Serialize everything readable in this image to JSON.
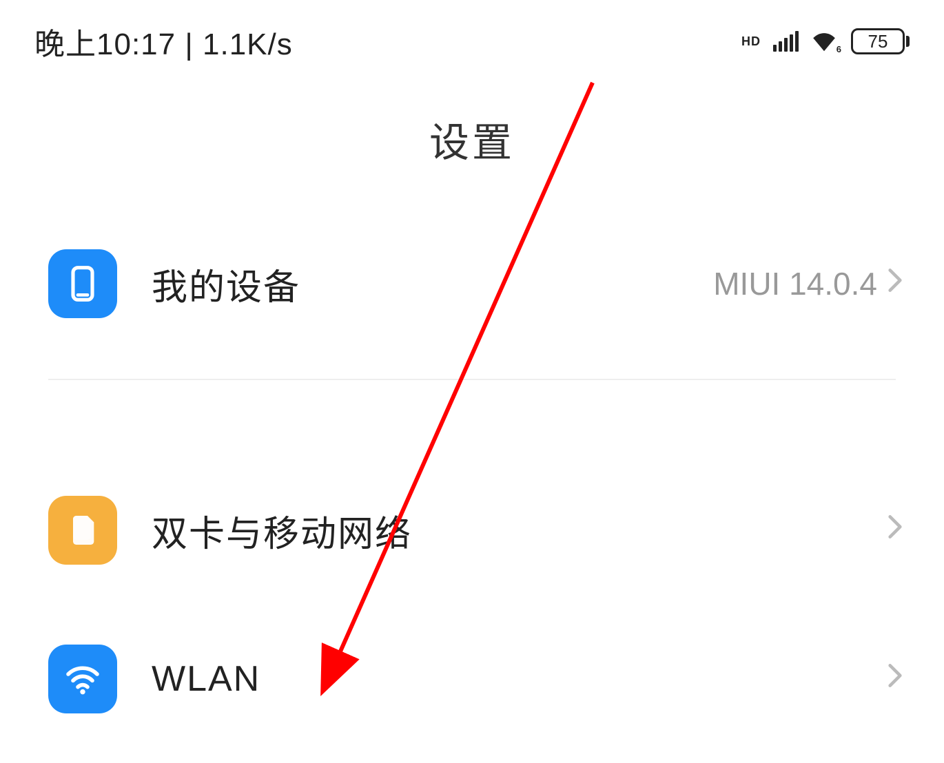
{
  "status_bar": {
    "time": "晚上10:17",
    "speed": "1.1K/s",
    "hd": "HD",
    "wifi_version": "6",
    "battery": "75"
  },
  "header": {
    "title": "设置"
  },
  "items": [
    {
      "label": "我的设备",
      "value": "MIUI 14.0.4",
      "icon": "device-icon",
      "color": "#1E8CF9"
    },
    {
      "label": "双卡与移动网络",
      "value": "",
      "icon": "sim-icon",
      "color": "#F6B03E"
    },
    {
      "label": "WLAN",
      "value": "",
      "icon": "wifi-icon",
      "color": "#1E8CF9"
    }
  ]
}
